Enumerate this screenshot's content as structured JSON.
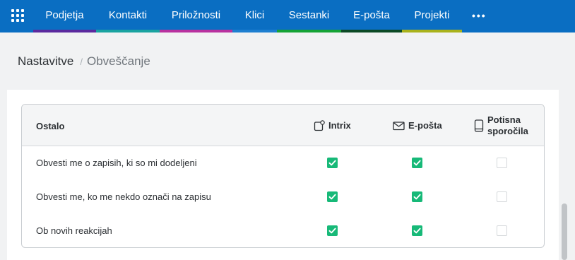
{
  "nav": {
    "items": [
      {
        "label": "Podjetja",
        "color": "#5b2a9e"
      },
      {
        "label": "Kontakti",
        "color": "#1aa3a0"
      },
      {
        "label": "Priložnosti",
        "color": "#b8329f"
      },
      {
        "label": "Klici",
        "color": "#1e7fd0"
      },
      {
        "label": "Sestanki",
        "color": "#16a335"
      },
      {
        "label": "E-pošta",
        "color": "#0c4a25"
      },
      {
        "label": "Projekti",
        "color": "#a9b21b"
      }
    ],
    "more_label": "•••",
    "apps_icon": "grid-apps-icon",
    "background": "#0a6ec2"
  },
  "breadcrumb": {
    "home": "Nastavitve",
    "separator": "/",
    "current": "Obveščanje"
  },
  "table": {
    "title": "Ostalo",
    "columns": [
      {
        "label": "Intrix",
        "icon": "intrix-notification-icon"
      },
      {
        "label": "E-pošta",
        "icon": "envelope-icon"
      },
      {
        "label": "Potisna sporočila",
        "icon": "mobile-phone-icon"
      }
    ],
    "rows": [
      {
        "label": "Obvesti me o zapisih, ki so mi dodeljeni",
        "values": [
          true,
          true,
          false
        ]
      },
      {
        "label": "Obvesti me, ko me nekdo označi na zapisu",
        "values": [
          true,
          true,
          false
        ]
      },
      {
        "label": "Ob novih reakcijah",
        "values": [
          true,
          true,
          false
        ]
      }
    ],
    "checked_color": "#17b978"
  }
}
